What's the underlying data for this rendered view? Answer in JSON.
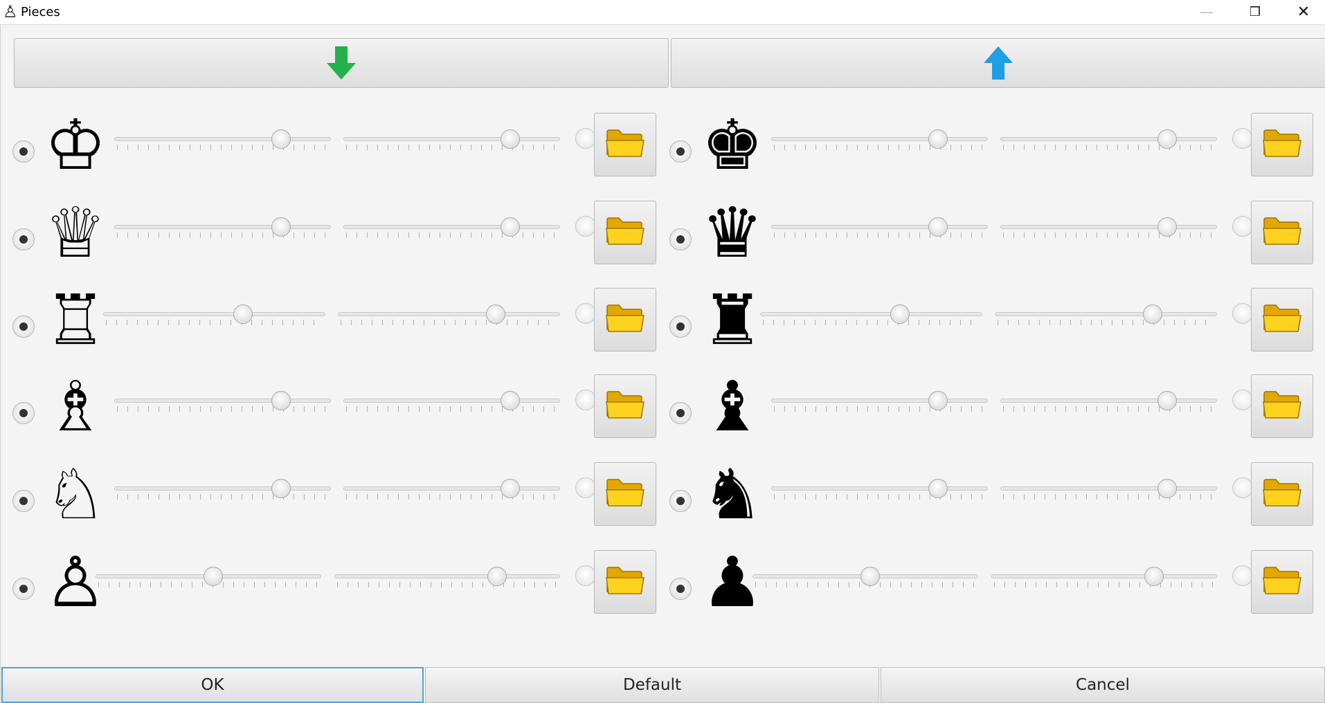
{
  "window": {
    "title": "Pieces",
    "app_icon": "chess-pawn-outline-icon",
    "minimize_glyph": "—",
    "restore_glyph": "❐",
    "close_glyph": "✕"
  },
  "top_buttons": {
    "left_icon": "green-down-arrow-icon",
    "right_icon": "blue-up-arrow-icon"
  },
  "colors": {
    "down_arrow": "#22b14c",
    "up_arrow": "#1e9fe6",
    "folder": "#ffd21f",
    "ok_focus_border": "#4aa3df"
  },
  "white_pieces": [
    {
      "piece": "king",
      "glyph": "♔",
      "slider1": 0.77,
      "slider2": 0.77
    },
    {
      "piece": "queen",
      "glyph": "♕",
      "slider1": 0.77,
      "slider2": 0.77
    },
    {
      "piece": "rook",
      "glyph": "♖",
      "slider1": 0.63,
      "slider2": 0.71
    },
    {
      "piece": "bishop",
      "glyph": "♗",
      "slider1": 0.77,
      "slider2": 0.77
    },
    {
      "piece": "knight",
      "glyph": "♘",
      "slider1": 0.77,
      "slider2": 0.77
    },
    {
      "piece": "pawn",
      "glyph": "♙",
      "slider1": 0.52,
      "slider2": 0.72
    }
  ],
  "black_pieces": [
    {
      "piece": "king",
      "glyph": "♚",
      "slider1": 0.77,
      "slider2": 0.77
    },
    {
      "piece": "queen",
      "glyph": "♛",
      "slider1": 0.77,
      "slider2": 0.77
    },
    {
      "piece": "rook",
      "glyph": "♜",
      "slider1": 0.63,
      "slider2": 0.71
    },
    {
      "piece": "bishop",
      "glyph": "♝",
      "slider1": 0.77,
      "slider2": 0.77
    },
    {
      "piece": "knight",
      "glyph": "♞",
      "slider1": 0.77,
      "slider2": 0.77
    },
    {
      "piece": "pawn",
      "glyph": "♟",
      "slider1": 0.52,
      "slider2": 0.72
    }
  ],
  "buttons": {
    "ok": "OK",
    "default": "Default",
    "cancel": "Cancel"
  }
}
